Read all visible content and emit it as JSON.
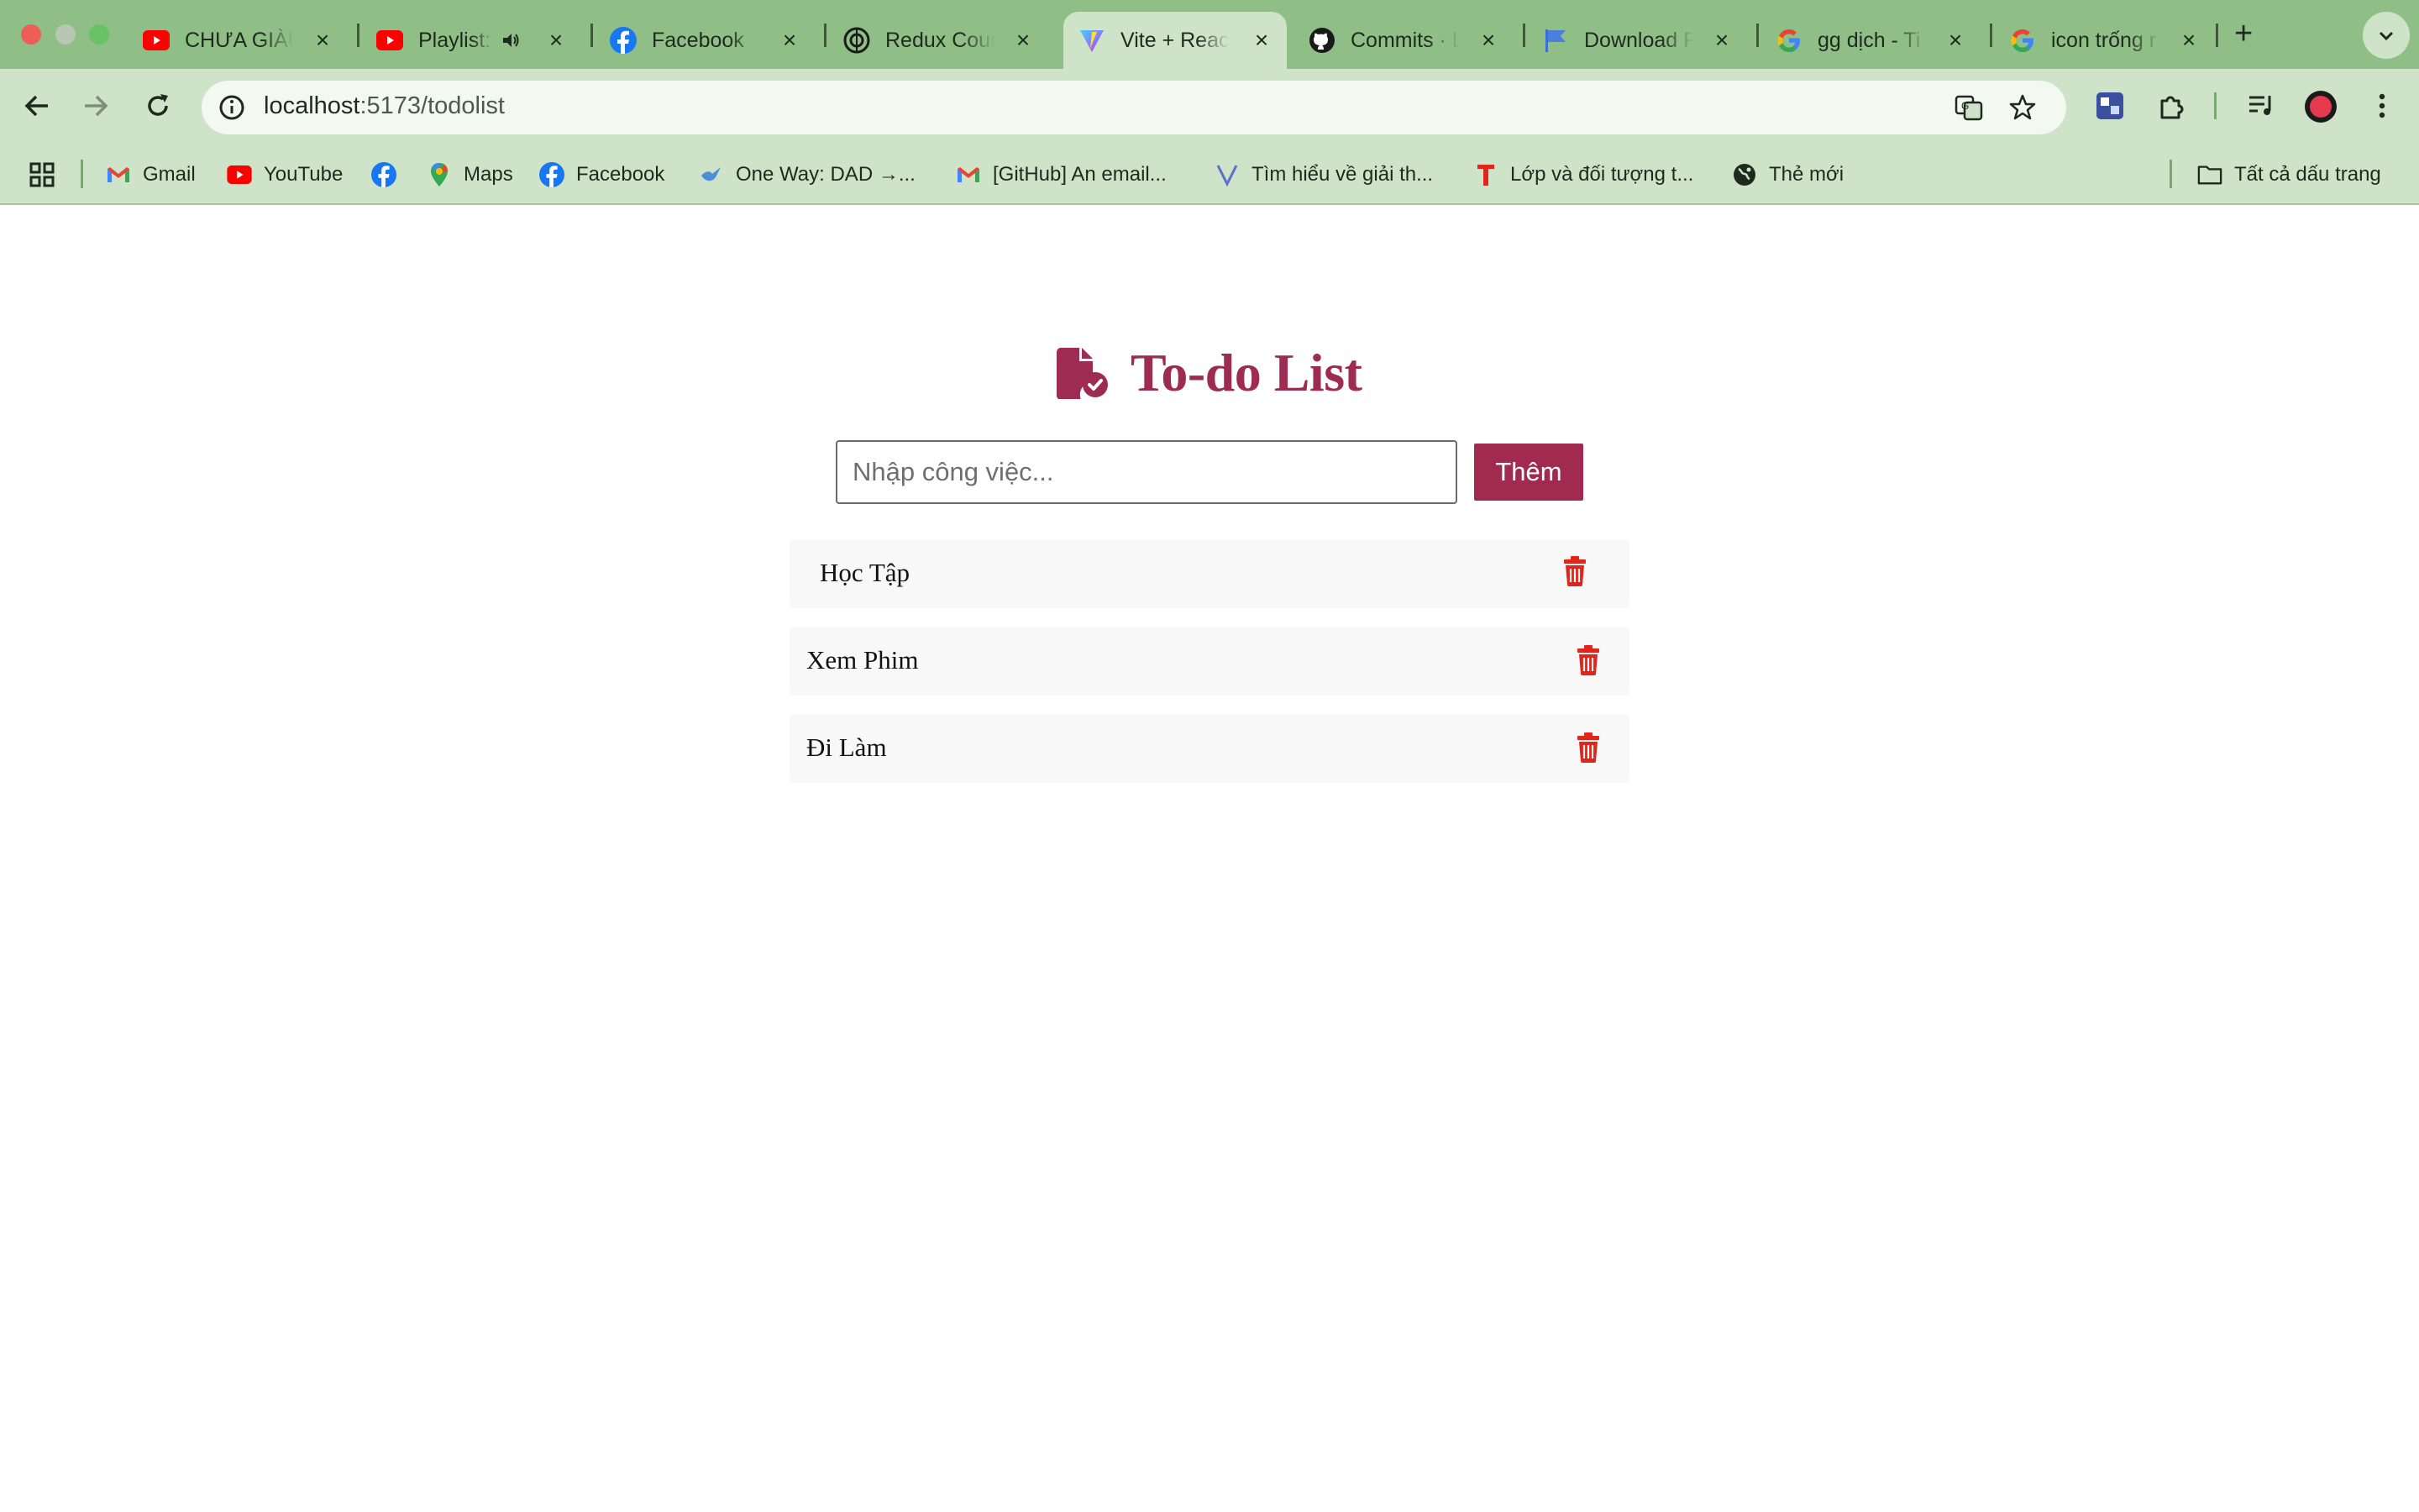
{
  "browser": {
    "tabs": [
      {
        "title": "CHƯA GIÀU VÌ ĐÂU",
        "favicon": "youtube-icon"
      },
      {
        "title": "Playlist:",
        "favicon": "youtube-icon",
        "audio": "speaker-icon"
      },
      {
        "title": "Facebook",
        "favicon": "facebook-icon"
      },
      {
        "title": "Redux Counter",
        "favicon": "openai-icon"
      },
      {
        "title": "Vite + React",
        "favicon": "vite-icon",
        "active": true
      },
      {
        "title": "Commits · L",
        "favicon": "github-icon"
      },
      {
        "title": "Download F",
        "favicon": "flag-icon"
      },
      {
        "title": "gg dịch - Ti",
        "favicon": "google-icon"
      },
      {
        "title": "icon trống r",
        "favicon": "google-icon"
      }
    ],
    "url_host": "localhost",
    "url_path": ":5173/todolist",
    "bookmarks": [
      {
        "label": "Gmail",
        "icon": "gmail-icon"
      },
      {
        "label": "YouTube",
        "icon": "youtube-icon"
      },
      {
        "label": "",
        "icon": "facebook-icon"
      },
      {
        "label": "Maps",
        "icon": "maps-icon"
      },
      {
        "label": "Facebook",
        "icon": "facebook-icon"
      },
      {
        "label": "One Way: DAD →...",
        "icon": "bird-icon"
      },
      {
        "label": "[GitHub] An email...",
        "icon": "gmail-icon"
      },
      {
        "label": "Tìm hiểu về giải th...",
        "icon": "vue-icon"
      },
      {
        "label": "Lớp và đối tượng t...",
        "icon": "t-icon"
      },
      {
        "label": "Thẻ mới",
        "icon": "globe-icon"
      }
    ],
    "all_bookmarks_label": "Tất cả dấu trang",
    "colors": {
      "frame": "#8fbf87",
      "toolbar": "#cfe3c8"
    }
  },
  "app": {
    "title": "To-do List",
    "input_placeholder": "Nhập công việc...",
    "add_label": "Thêm",
    "todos": [
      "Học Tập",
      "Xem Phim",
      "Đi Làm"
    ],
    "colors": {
      "accent": "#9e2b52",
      "delete": "#e0261b"
    }
  }
}
